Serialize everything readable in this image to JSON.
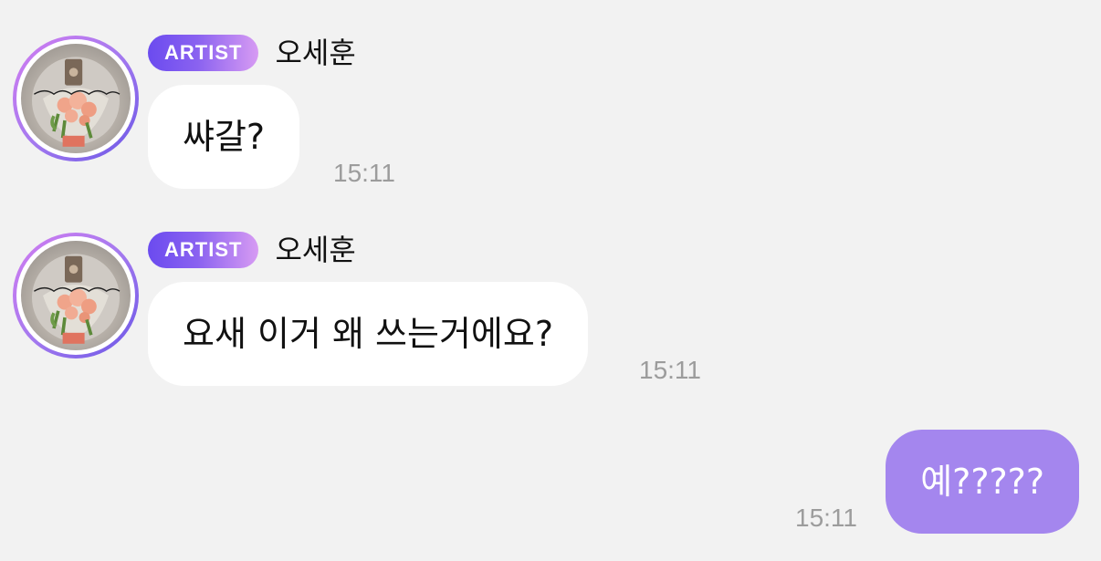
{
  "conversation": {
    "messages": [
      {
        "badge": "ARTIST",
        "sender": "오세훈",
        "text": "쌰갈?",
        "time": "15:11"
      },
      {
        "badge": "ARTIST",
        "sender": "오세훈",
        "text": "요새 이거 왜 쓰는거에요?",
        "time": "15:11"
      }
    ],
    "reply": {
      "text": "예?????",
      "time": "15:11"
    }
  },
  "avatar": {
    "icon": "bouquet-photo-avatar",
    "handwriting": "언제나 세훈이편"
  },
  "colors": {
    "background": "#f2f2f2",
    "bubble_incoming": "#ffffff",
    "bubble_outgoing": "#a486ee",
    "badge_gradient_start": "#6b4bef",
    "badge_gradient_end": "#d79bf3",
    "timestamp": "#9c9c9c"
  }
}
